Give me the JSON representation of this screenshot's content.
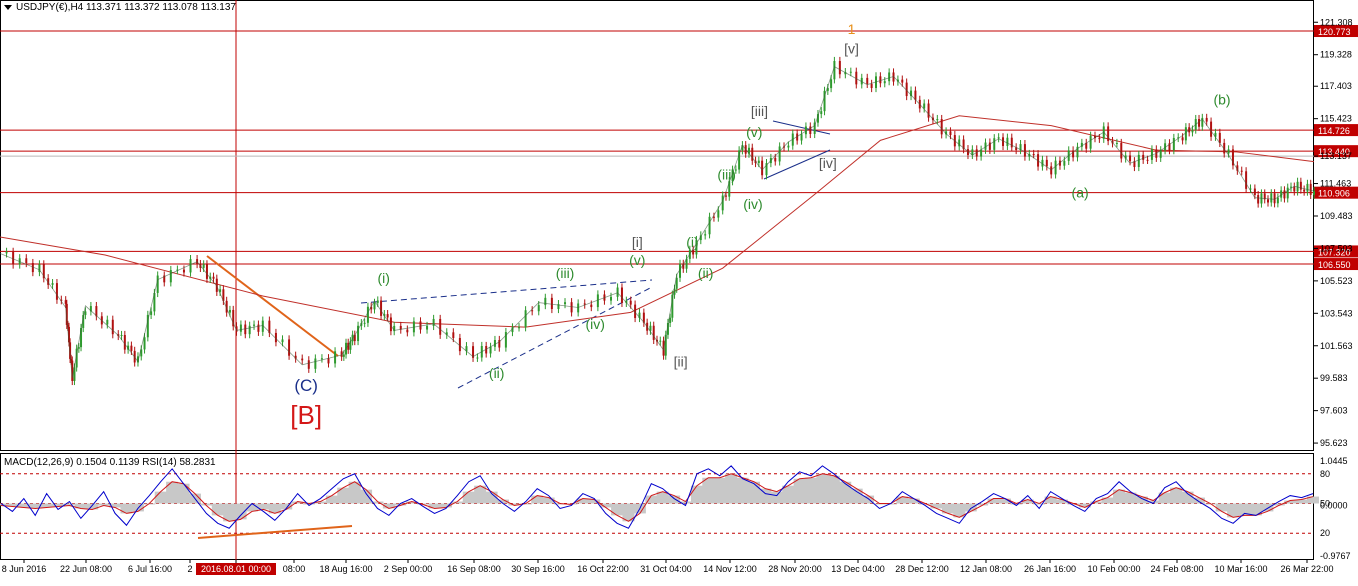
{
  "chart_data": [
    {
      "type": "candlestick",
      "title": "USDJPY(€),H4 113.371 113.372 113.078 113.137",
      "symbol": "USDJPY(€)",
      "timeframe": "H4",
      "ohlc": [
        "113.371",
        "113.372",
        "113.078",
        "113.137"
      ],
      "ylim": [
        95.2,
        122.3
      ],
      "y_ticks": [
        "121.308",
        "119.328",
        "117.403",
        "115.423",
        "113.137",
        "111.463",
        "109.483",
        "107.503",
        "105.523",
        "103.543",
        "101.563",
        "99.583",
        "97.603",
        "95.623"
      ],
      "x_labels": [
        "8 Jun 2016",
        "22 Jun 08:00",
        "6 Jul 16:00",
        "2",
        "2016.08.01 00:00",
        "08:00",
        "18 Aug 16:00",
        "2 Sep 00:00",
        "16 Sep 08:00",
        "30 Sep 16:00",
        "16 Oct 22:00",
        "31 Oct 04:00",
        "14 Nov 12:00",
        "28 Nov 20:00",
        "13 Dec 04:00",
        "28 Dec 12:00",
        "12 Jan 08:00",
        "26 Jan 16:00",
        "10 Feb 00:00",
        "24 Feb 08:00",
        "10 Mar 16:00",
        "26 Mar 22:00"
      ],
      "horizontal_levels": [
        {
          "value": 120.773,
          "label": "120.773",
          "color": "#c00000"
        },
        {
          "value": 114.726,
          "label": "114.726",
          "color": "#c00000"
        },
        {
          "value": 113.44,
          "label": "113.440",
          "color": "#c00000"
        },
        {
          "value": 110.906,
          "label": "110.906",
          "color": "#c00000"
        },
        {
          "value": 107.32,
          "label": "107.320",
          "color": "#c00000"
        },
        {
          "value": 106.55,
          "label": "106.550",
          "color": "#c00000"
        }
      ],
      "current_price": "113.137",
      "price_path": [
        {
          "x": 0,
          "y": 107.2
        },
        {
          "x": 0.03,
          "y": 106.2
        },
        {
          "x": 0.05,
          "y": 103.9
        },
        {
          "x": 0.055,
          "y": 99.6
        },
        {
          "x": 0.065,
          "y": 104.0
        },
        {
          "x": 0.09,
          "y": 102.2
        },
        {
          "x": 0.105,
          "y": 100.6
        },
        {
          "x": 0.12,
          "y": 105.6
        },
        {
          "x": 0.15,
          "y": 106.7
        },
        {
          "x": 0.165,
          "y": 105.2
        },
        {
          "x": 0.18,
          "y": 102.5
        },
        {
          "x": 0.2,
          "y": 102.8
        },
        {
          "x": 0.23,
          "y": 100.4
        },
        {
          "x": 0.26,
          "y": 101.0
        },
        {
          "x": 0.27,
          "y": 102.2
        },
        {
          "x": 0.285,
          "y": 104.3
        },
        {
          "x": 0.3,
          "y": 102.5
        },
        {
          "x": 0.33,
          "y": 102.9
        },
        {
          "x": 0.36,
          "y": 100.9
        },
        {
          "x": 0.38,
          "y": 101.8
        },
        {
          "x": 0.41,
          "y": 104.2
        },
        {
          "x": 0.44,
          "y": 103.9
        },
        {
          "x": 0.47,
          "y": 104.8
        },
        {
          "x": 0.49,
          "y": 103.0
        },
        {
          "x": 0.505,
          "y": 101.3
        },
        {
          "x": 0.515,
          "y": 105.9
        },
        {
          "x": 0.53,
          "y": 107.8
        },
        {
          "x": 0.55,
          "y": 110.4
        },
        {
          "x": 0.565,
          "y": 113.8
        },
        {
          "x": 0.58,
          "y": 112.3
        },
        {
          "x": 0.6,
          "y": 114.0
        },
        {
          "x": 0.62,
          "y": 115.0
        },
        {
          "x": 0.635,
          "y": 118.6
        },
        {
          "x": 0.66,
          "y": 117.5
        },
        {
          "x": 0.68,
          "y": 118.0
        },
        {
          "x": 0.7,
          "y": 116.3
        },
        {
          "x": 0.72,
          "y": 114.5
        },
        {
          "x": 0.74,
          "y": 113.2
        },
        {
          "x": 0.76,
          "y": 114.2
        },
        {
          "x": 0.78,
          "y": 113.4
        },
        {
          "x": 0.8,
          "y": 112.3
        },
        {
          "x": 0.82,
          "y": 113.6
        },
        {
          "x": 0.84,
          "y": 114.6
        },
        {
          "x": 0.86,
          "y": 112.7
        },
        {
          "x": 0.88,
          "y": 113.3
        },
        {
          "x": 0.9,
          "y": 114.4
        },
        {
          "x": 0.915,
          "y": 115.4
        },
        {
          "x": 0.935,
          "y": 113.2
        },
        {
          "x": 0.955,
          "y": 110.6
        },
        {
          "x": 0.97,
          "y": 110.5
        },
        {
          "x": 0.985,
          "y": 111.3
        },
        {
          "x": 1.0,
          "y": 111.0
        }
      ],
      "moving_average_path": [
        {
          "x": 0,
          "y": 108.2
        },
        {
          "x": 0.08,
          "y": 107.1
        },
        {
          "x": 0.2,
          "y": 104.6
        },
        {
          "x": 0.3,
          "y": 103.0
        },
        {
          "x": 0.4,
          "y": 102.7
        },
        {
          "x": 0.48,
          "y": 103.6
        },
        {
          "x": 0.55,
          "y": 106.3
        },
        {
          "x": 0.62,
          "y": 110.8
        },
        {
          "x": 0.67,
          "y": 114.1
        },
        {
          "x": 0.73,
          "y": 115.6
        },
        {
          "x": 0.8,
          "y": 115.0
        },
        {
          "x": 0.88,
          "y": 113.5
        },
        {
          "x": 0.94,
          "y": 113.4
        },
        {
          "x": 1.0,
          "y": 112.8
        }
      ],
      "wave_labels": [
        {
          "text": "(C)",
          "x": 0.233,
          "y": 98.8,
          "color": "#1a2f8a"
        },
        {
          "text": "[B]",
          "x": 0.233,
          "y": 96.8,
          "color": "#d41818"
        },
        {
          "text": "(i)",
          "x": 0.292,
          "y": 105.4,
          "color": "#2e8b2e"
        },
        {
          "text": "(ii)",
          "x": 0.378,
          "y": 99.6,
          "color": "#2e8b2e"
        },
        {
          "text": "(iii)",
          "x": 0.43,
          "y": 105.7,
          "color": "#2e8b2e"
        },
        {
          "text": "(iv)",
          "x": 0.453,
          "y": 102.6,
          "color": "#2e8b2e"
        },
        {
          "text": "(v)",
          "x": 0.485,
          "y": 106.5,
          "color": "#2e8b2e"
        },
        {
          "text": "[i]",
          "x": 0.485,
          "y": 107.6,
          "color": "#555555"
        },
        {
          "text": "[ii]",
          "x": 0.518,
          "y": 100.3,
          "color": "#555555"
        },
        {
          "text": "(i)",
          "x": 0.527,
          "y": 107.6,
          "color": "#2e8b2e"
        },
        {
          "text": "(ii)",
          "x": 0.537,
          "y": 105.7,
          "color": "#2e8b2e"
        },
        {
          "text": "(iii)",
          "x": 0.553,
          "y": 111.7,
          "color": "#2e8b2e"
        },
        {
          "text": "(iv)",
          "x": 0.573,
          "y": 109.9,
          "color": "#2e8b2e"
        },
        {
          "text": "(v)",
          "x": 0.574,
          "y": 114.3,
          "color": "#2e8b2e"
        },
        {
          "text": "[iii]",
          "x": 0.578,
          "y": 115.6,
          "color": "#555555"
        },
        {
          "text": "[iv]",
          "x": 0.63,
          "y": 112.4,
          "color": "#555555"
        },
        {
          "text": "[v]",
          "x": 0.648,
          "y": 119.4,
          "color": "#555555"
        },
        {
          "text": "1",
          "x": 0.648,
          "y": 120.6,
          "color": "#e8901a"
        },
        {
          "text": "(a)",
          "x": 0.822,
          "y": 110.6,
          "color": "#2e8b2e"
        },
        {
          "text": "(b)",
          "x": 0.93,
          "y": 116.3,
          "color": "#2e8b2e"
        }
      ]
    },
    {
      "type": "line",
      "title": "MACD(12,26,9) 0.1504 0.1139 RSI(14) 58.2831",
      "indicator_params": "MACD(12,26,9) 0.1504 0.1139 RSI(14) 58.2831",
      "right_labels": [
        "1.0445",
        "80",
        "50",
        "0.0000",
        "20",
        "-0.9767"
      ],
      "rsi_reference_levels": [
        80,
        50,
        20
      ],
      "series": [
        {
          "name": "RSI(14)",
          "color": "#0000cc",
          "values": [
            50,
            42,
            55,
            38,
            60,
            44,
            52,
            35,
            48,
            62,
            40,
            28,
            45,
            58,
            72,
            85,
            70,
            55,
            40,
            30,
            25,
            38,
            50,
            42,
            33,
            45,
            60,
            48,
            55,
            65,
            75,
            80,
            60,
            45,
            38,
            50,
            55,
            47,
            40,
            45,
            58,
            72,
            78,
            60,
            50,
            42,
            52,
            65,
            58,
            45,
            48,
            60,
            55,
            40,
            30,
            25,
            45,
            70,
            65,
            55,
            48,
            80,
            85,
            78,
            88,
            75,
            70,
            60,
            58,
            72,
            82,
            78,
            88,
            80,
            70,
            62,
            55,
            45,
            50,
            62,
            55,
            48,
            40,
            35,
            30,
            45,
            52,
            60,
            55,
            48,
            58,
            45,
            62,
            55,
            48,
            42,
            55,
            60,
            72,
            62,
            55,
            50,
            66,
            72,
            60,
            52,
            45,
            35,
            30,
            40,
            38,
            45,
            52,
            58,
            56,
            60
          ]
        },
        {
          "name": "MACD",
          "color": "#d01818",
          "values": [
            48,
            47,
            46,
            45,
            46,
            47,
            48,
            45,
            44,
            48,
            46,
            40,
            42,
            50,
            62,
            72,
            70,
            60,
            48,
            38,
            32,
            34,
            42,
            44,
            40,
            44,
            52,
            50,
            52,
            58,
            66,
            72,
            64,
            52,
            45,
            48,
            52,
            49,
            45,
            46,
            52,
            62,
            68,
            62,
            54,
            48,
            50,
            58,
            56,
            50,
            49,
            55,
            54,
            46,
            38,
            32,
            40,
            58,
            62,
            58,
            52,
            68,
            76,
            76,
            80,
            76,
            72,
            65,
            62,
            68,
            75,
            76,
            80,
            78,
            72,
            65,
            58,
            50,
            50,
            57,
            55,
            50,
            45,
            40,
            36,
            42,
            48,
            55,
            55,
            50,
            54,
            50,
            57,
            54,
            50,
            46,
            52,
            56,
            64,
            61,
            57,
            53,
            61,
            66,
            62,
            56,
            50,
            42,
            36,
            38,
            38,
            42,
            48,
            53,
            54,
            57
          ]
        }
      ],
      "sub_x_labels": [
        "8 Jun 2016",
        "22 Jun 08:00",
        "6 Jul 16:00",
        "2016.08.01 00:00",
        "18 Aug 16:00",
        "2 Sep 00:00",
        "16 Sep 08:00",
        "30 Sep 16:00",
        "16 Oct 22:00",
        "31 Oct 04:00",
        "14 Nov 12:00",
        "28 Nov 20:00",
        "13 Dec 04:00",
        "28 Dec 12:00",
        "12 Jan 08:00",
        "26 Jan 16:00",
        "10 Feb 00:00",
        "24 Feb 08:00",
        "10 Mar 16:00",
        "26 Mar 22:00"
      ]
    }
  ]
}
